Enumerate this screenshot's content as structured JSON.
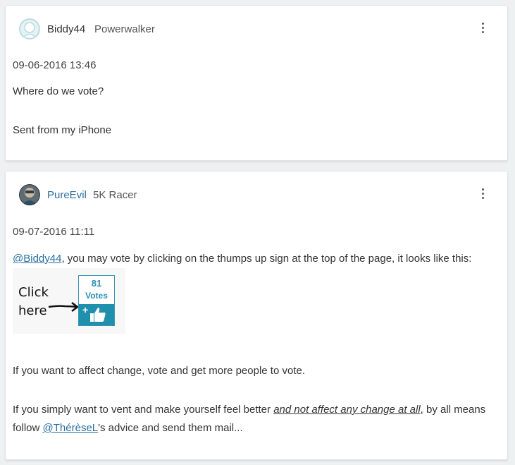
{
  "post1": {
    "username": "Biddy44",
    "rank": "Powerwalker",
    "date": "09-06-2016 13:46",
    "body_line1": "Where do we vote?",
    "body_line2": "Sent from my iPhone"
  },
  "post2": {
    "username": "PureEvil",
    "rank": "5K Racer",
    "date": "09-07-2016 11:11",
    "mention1": "@Biddy44",
    "line1_rest": ", you may vote by clicking on the thumps up sign at the top of the page, it looks like this:",
    "embed": {
      "click_label": "Click",
      "here_label": "here",
      "vote_count": "81",
      "votes_label": "Votes",
      "plus": "+"
    },
    "para2": "If you want to affect change, vote and get more people to vote.",
    "para3_start": "If you simply want to vent and make yourself feel better ",
    "para3_em": "and not affect any change at all",
    "para3_mid": ", by all means follow ",
    "mention2": "@ThérèseL",
    "para3_end": "'s advice and send them mail..."
  },
  "icons": {
    "menu": "more-vertical-icon",
    "avatar_default": "default-avatar-icon",
    "avatar_user": "user-photo-avatar",
    "thumbs_up": "thumbs-up-icon",
    "arrow": "arrow-right-icon"
  },
  "colors": {
    "link": "#2a6f9e",
    "vote_accent": "#1f8fae"
  }
}
